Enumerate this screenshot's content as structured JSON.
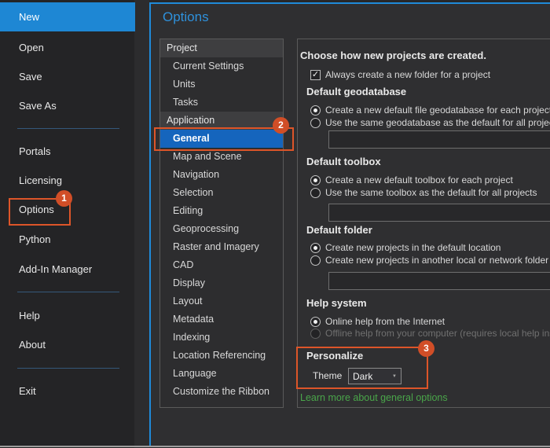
{
  "title": "Options",
  "callouts": {
    "step1": "1",
    "step2": "2",
    "step3": "3"
  },
  "sidebar": {
    "items": [
      {
        "label": "New"
      },
      {
        "label": "Open"
      },
      {
        "label": "Save"
      },
      {
        "label": "Save As"
      },
      {
        "label": "Portals"
      },
      {
        "label": "Licensing"
      },
      {
        "label": "Options"
      },
      {
        "label": "Python"
      },
      {
        "label": "Add-In Manager"
      },
      {
        "label": "Help"
      },
      {
        "label": "About"
      },
      {
        "label": "Exit"
      }
    ]
  },
  "nav": {
    "project_header": "Project",
    "project_items": [
      {
        "label": "Current Settings"
      },
      {
        "label": "Units"
      },
      {
        "label": "Tasks"
      }
    ],
    "application_header": "Application",
    "application_items": [
      {
        "label": "General"
      },
      {
        "label": "Map and Scene"
      },
      {
        "label": "Navigation"
      },
      {
        "label": "Selection"
      },
      {
        "label": "Editing"
      },
      {
        "label": "Geoprocessing"
      },
      {
        "label": "Raster and Imagery"
      },
      {
        "label": "CAD"
      },
      {
        "label": "Display"
      },
      {
        "label": "Layout"
      },
      {
        "label": "Metadata"
      },
      {
        "label": "Indexing"
      },
      {
        "label": "Location Referencing"
      },
      {
        "label": "Language"
      },
      {
        "label": "Customize the Ribbon"
      }
    ],
    "selected": "General"
  },
  "panel": {
    "intro": "Choose how new projects are created.",
    "folder_checkbox": "Always create a new folder for a project",
    "geodatabase": {
      "title": "Default geodatabase",
      "radio1": "Create a new default file geodatabase for each project",
      "radio2": "Use the same geodatabase as the default for all projects"
    },
    "toolbox": {
      "title": "Default toolbox",
      "radio1": "Create a new default toolbox for each project",
      "radio2": "Use the same toolbox as the default for all projects"
    },
    "folder": {
      "title": "Default folder",
      "radio1": "Create new projects in the default location",
      "radio2": "Create new projects in another local or network folder"
    },
    "help": {
      "title": "Help system",
      "radio1": "Online help from the Internet",
      "radio2": "Offline help from your computer (requires local help ins"
    },
    "personalize": {
      "title": "Personalize",
      "theme_label": "Theme",
      "theme_value": "Dark"
    },
    "link": "Learn more about general options"
  },
  "colors": {
    "accent_blue": "#1f8ad9",
    "selection_blue": "#1e87d4",
    "nav_selection_blue": "#1565bd",
    "callout_orange": "#dd5529",
    "badge_orange": "#d14e27",
    "link_green": "#4aa64a",
    "title_blue": "#2e91dc"
  },
  "icons": {
    "check": "✓",
    "dropdown_arrow": "▼"
  }
}
